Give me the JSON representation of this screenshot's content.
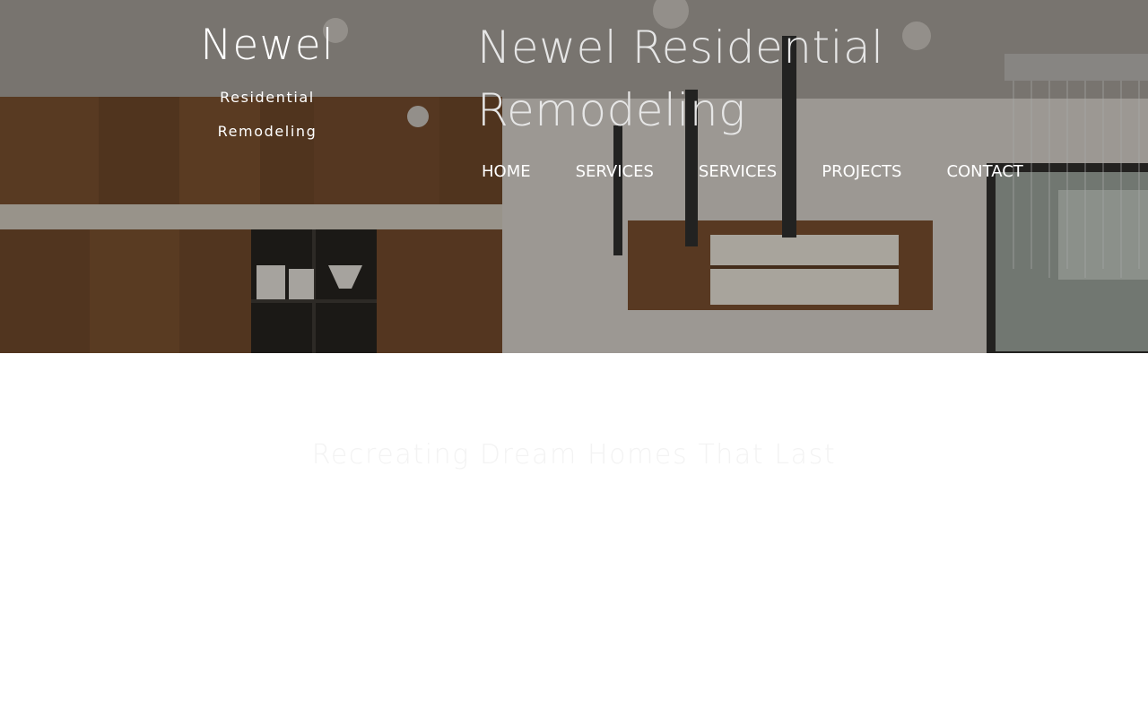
{
  "header": {
    "logo": {
      "title": "Newel",
      "subtitle_line1": "Residential",
      "subtitle_line2": "Remodeling"
    },
    "site_title": "Newel Residential Remodeling",
    "nav": [
      {
        "label": "HOME"
      },
      {
        "label": "SERVICES"
      },
      {
        "label": "SERVICES"
      },
      {
        "label": "PROJECTS"
      },
      {
        "label": "CONTACT"
      }
    ]
  },
  "main": {
    "tagline": "Recreating Dream Homes That Last"
  },
  "colors": {
    "nav_text": "#ffffff",
    "title_text": "#e6e6e6",
    "tagline_text": "#f3f3f3",
    "page_bg": "#ffffff"
  }
}
